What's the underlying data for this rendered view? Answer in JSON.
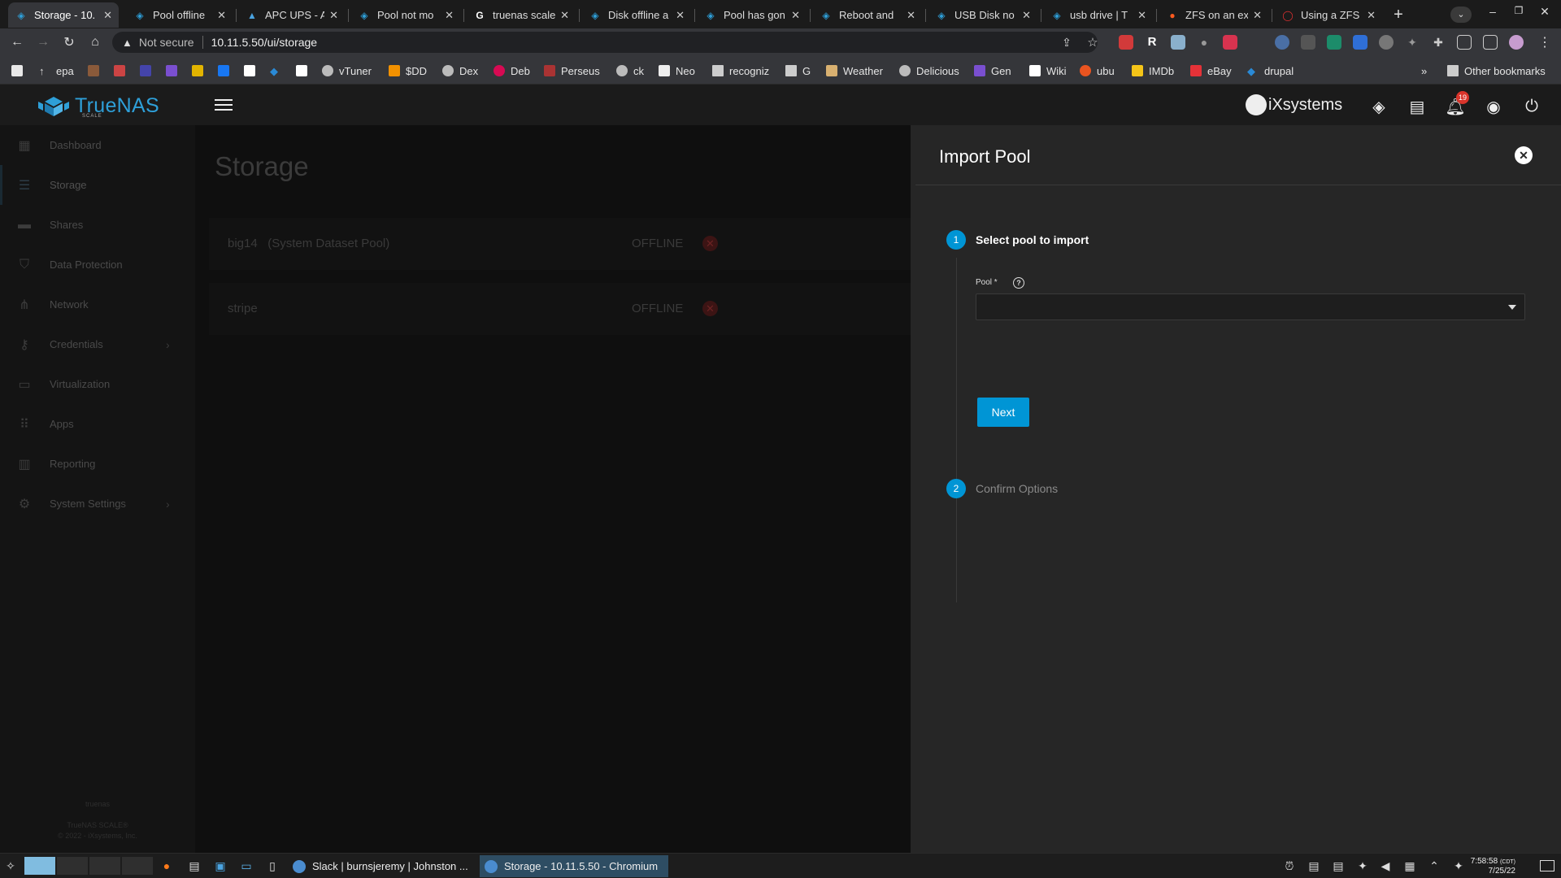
{
  "browser": {
    "tabs": [
      {
        "title": "Storage - 10.",
        "active": true
      },
      {
        "title": "Pool offline"
      },
      {
        "title": "APC UPS - Ar"
      },
      {
        "title": "Pool not mo"
      },
      {
        "title": "truenas scale"
      },
      {
        "title": "Disk offline a"
      },
      {
        "title": "Pool has gon"
      },
      {
        "title": "Reboot and"
      },
      {
        "title": "USB Disk no"
      },
      {
        "title": "usb drive | T"
      },
      {
        "title": "ZFS on an ex"
      },
      {
        "title": "Using a ZFS"
      }
    ],
    "security_label": "Not secure",
    "url": "10.11.5.50/ui/storage",
    "bookmarks": [
      "epa",
      "vTuner",
      "$DD",
      "Dex",
      "Deb",
      "Perseus",
      "ck",
      "Neo",
      "recogniz",
      "G",
      "Weather",
      "Delicious",
      "Gen",
      "Wiki",
      "ubu",
      "IMDb",
      "eBay",
      "drupal"
    ],
    "other_bookmarks": "Other bookmarks"
  },
  "app": {
    "brand": "TrueNAS",
    "brand_sub": "SCALE",
    "vendor": "iXsystems",
    "notification_count": "19"
  },
  "sidebar": {
    "items": [
      {
        "label": "Dashboard",
        "icon": "dashboard-icon"
      },
      {
        "label": "Storage",
        "icon": "storage-icon",
        "active": true
      },
      {
        "label": "Shares",
        "icon": "folder-icon"
      },
      {
        "label": "Data Protection",
        "icon": "shield-icon"
      },
      {
        "label": "Network",
        "icon": "network-icon"
      },
      {
        "label": "Credentials",
        "icon": "key-icon",
        "has_children": true
      },
      {
        "label": "Virtualization",
        "icon": "laptop-icon"
      },
      {
        "label": "Apps",
        "icon": "apps-grid-icon"
      },
      {
        "label": "Reporting",
        "icon": "chart-icon"
      },
      {
        "label": "System Settings",
        "icon": "gear-icon",
        "has_children": true
      }
    ],
    "footer_host": "truenas",
    "footer_version": "TrueNAS SCALE®",
    "footer_copyright": "© 2022 - iXsystems, Inc."
  },
  "main": {
    "title": "Storage",
    "pools": [
      {
        "name": "big14   (System Dataset Pool)",
        "status": "OFFLINE"
      },
      {
        "name": "stripe",
        "status": "OFFLINE"
      }
    ]
  },
  "panel": {
    "title": "Import Pool",
    "steps": [
      {
        "number": "1",
        "label": "Select pool to import",
        "active": true
      },
      {
        "number": "2",
        "label": "Confirm Options",
        "active": false
      }
    ],
    "pool_field_label": "Pool *",
    "pool_value": "",
    "next_label": "Next"
  },
  "taskbar": {
    "tasks": [
      {
        "label": "Slack | burnsjeremy | Johnston ..."
      },
      {
        "label": "Storage - 10.11.5.50 - Chromium",
        "active": true
      }
    ],
    "time": "7:58:58",
    "tz": "(CDT)",
    "date": "7/25/22"
  },
  "colors": {
    "accent": "#0095d5",
    "brand_blue": "#2e9fd8",
    "panel_bg": "#262626",
    "notification_badge": "#d9342b"
  }
}
